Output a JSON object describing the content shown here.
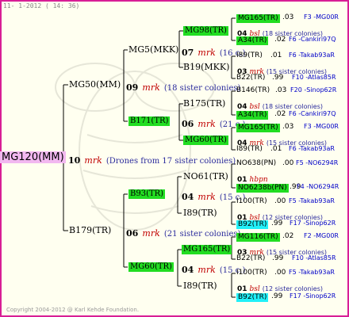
{
  "header": "11-  1-2012  ( 14: 36)",
  "footer": "Copyright 2004-2012 @ Karl Kehde Foundation.",
  "root": {
    "label": "MG120(MM)",
    "gen": "10",
    "mrk": "mrk",
    "note": "(Drones from 17 sister colonies)"
  },
  "l1": [
    {
      "label": "MG50(MM)",
      "gen": "09",
      "mrk": "mrk",
      "note": "(18 sister colonies)"
    },
    {
      "label": "B179(TR)",
      "gen": "06",
      "mrk": "mrk",
      "note": "(21 sister colonies)"
    }
  ],
  "l2": [
    {
      "label": "MG5(MKK)",
      "gen": "07",
      "mrk": "mrk",
      "note": "(16 c.)"
    },
    {
      "label": "B171(TR)",
      "gen": "06",
      "mrk": "mrk",
      "note": "(21 c.)"
    },
    {
      "label": "B93(TR)",
      "gen": "04",
      "mrk": "mrk",
      "note": "(15 c.)"
    },
    {
      "label": "MG60(TR)",
      "gen": "04",
      "mrk": "mrk",
      "note": "(15 c.)"
    }
  ],
  "l3": [
    {
      "label": "MG98(TR)",
      "gen": "04",
      "mrk": "bsl",
      "note": "(18 sister colonies)"
    },
    {
      "label": "B19(MKK)",
      "gen": "03",
      "mrk": "mrk",
      "note": "(15 sister colonies)"
    },
    {
      "label": "B175(TR)",
      "gen": "04",
      "mrk": "bsl",
      "note": "(18 sister colonies)"
    },
    {
      "label": "MG60(TR)",
      "gen": "04",
      "mrk": "mrk",
      "note": "(15 sister colonies)"
    },
    {
      "label": "NO61(TR)",
      "gen": "01",
      "mrk": "hbpn",
      "note": ""
    },
    {
      "label": "I89(TR)",
      "gen": "01",
      "mrk": "bsl",
      "note": "(12 sister colonies)"
    },
    {
      "label": "MG165(TR)",
      "gen": "03",
      "mrk": "mrk",
      "note": "(15 sister colonies)"
    },
    {
      "label": "I89(TR)",
      "gen": "01",
      "mrk": "bsl",
      "note": "(12 sister colonies)"
    }
  ],
  "l4": [
    {
      "label": "MG165(TR)",
      "val": ".03",
      "right": "F3 -MG00R"
    },
    {
      "label": "A34(TR)",
      "val": ".02",
      "right": "F6 -Cankiri97Q"
    },
    {
      "label": "I89(TR)",
      "val": ".01",
      "right": "F6 -Takab93aR"
    },
    {
      "label": "B22(TR)",
      "val": ".99",
      "right": "F10 -Atlas85R"
    },
    {
      "label": "B146(TR)",
      "val": ".03",
      "right": "F20 -Sinop62R"
    },
    {
      "label": "A34(TR)",
      "val": ".02",
      "right": "F6 -Cankiri97Q"
    },
    {
      "label": "MG165(TR)",
      "val": ".03",
      "right": "F3 -MG00R"
    },
    {
      "label": "I89(TR)",
      "val": ".01",
      "right": "F6 -Takab93aR"
    },
    {
      "label": "NO638(PN)",
      "val": ".00",
      "right": "F5 -NO6294R"
    },
    {
      "label": "NO6238b(PN)",
      "val": ".99",
      "right": "F4 -NO6294R"
    },
    {
      "label": "I100(TR)",
      "val": ".00",
      "right": "F5 -Takab93aR"
    },
    {
      "label": "B92(TR)",
      "val": ".99",
      "right": "F17 -Sinop62R"
    },
    {
      "label": "MG116(TR)",
      "val": ".02",
      "right": "F2 -MG00R"
    },
    {
      "label": "B22(TR)",
      "val": ".99",
      "right": "F10 -Atlas85R"
    },
    {
      "label": "I100(TR)",
      "val": ".00",
      "right": "F5 -Takab93aR"
    },
    {
      "label": "B92(TR)",
      "val": ".99",
      "right": "F17 -Sinop62R"
    }
  ]
}
